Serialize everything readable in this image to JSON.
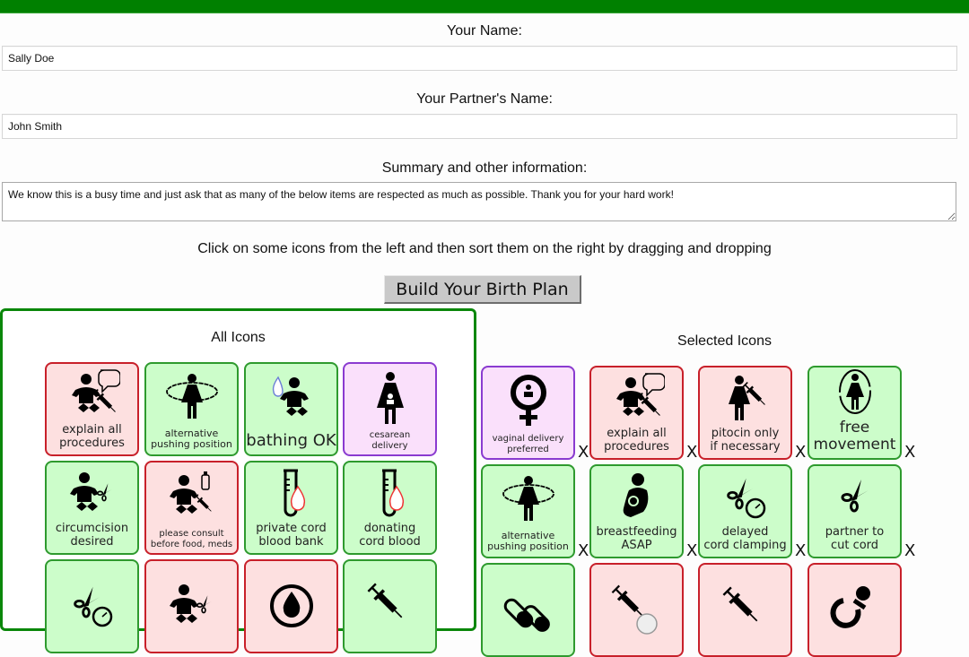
{
  "form": {
    "your_name_label": "Your Name:",
    "your_name_value": "Sally Doe",
    "partner_name_label": "Your Partner's Name:",
    "partner_name_value": "John Smith",
    "summary_label": "Summary and other information:",
    "summary_value": "We know this is a busy time and just ask that as many of the below items are respected as much as possible. Thank you for your hard work!",
    "instructions": "Click on some icons from the left and then sort them on the right by dragging and dropping",
    "build_button_label": "Build Your Birth Plan"
  },
  "colors": {
    "header_bar": "#008000",
    "green_tile_bg": "#ccfdca",
    "green_tile_border": "#2e9a2e",
    "red_tile_bg": "#fde0e0",
    "red_tile_border": "#c8202a",
    "purple_tile_bg": "#fae0fb",
    "purple_tile_border": "#8a3bd0",
    "panel_border": "#0a870a"
  },
  "all_icons": {
    "title": "All Icons",
    "items": [
      {
        "label": "explain all\nprocedures",
        "color": "red",
        "icon": "baby-speech-syringe-icon"
      },
      {
        "label": "alternative\npushing position",
        "color": "green",
        "icon": "woman-orbit-icon"
      },
      {
        "label": "bathing OK",
        "color": "green",
        "icon": "baby-water-drop-icon"
      },
      {
        "label": "cesarean\ndelivery",
        "color": "purple",
        "icon": "woman-with-baby-icon"
      },
      {
        "label": "circumcision\ndesired",
        "color": "green",
        "icon": "baby-scissors-icon"
      },
      {
        "label": "please consult\nbefore food, meds",
        "color": "red",
        "icon": "baby-bottle-syringe-icon"
      },
      {
        "label": "private cord\nblood bank",
        "color": "green",
        "icon": "test-tube-blood-icon"
      },
      {
        "label": "donating\ncord blood",
        "color": "green",
        "icon": "test-tube-blood-icon"
      },
      {
        "label": "",
        "color": "green",
        "icon": "scissors-clock-icon"
      },
      {
        "label": "",
        "color": "red",
        "icon": "baby-scissors-icon"
      },
      {
        "label": "",
        "color": "red",
        "icon": "blood-drop-circle-icon"
      },
      {
        "label": "",
        "color": "green",
        "icon": "syringe-icon"
      }
    ]
  },
  "selected_icons": {
    "title": "Selected Icons",
    "remove_label": "X",
    "items": [
      {
        "label": "vaginal delivery\npreferred",
        "color": "purple",
        "icon": "female-symbol-baby-icon"
      },
      {
        "label": "explain all\nprocedures",
        "color": "red",
        "icon": "baby-speech-syringe-icon"
      },
      {
        "label": "pitocin only\nif necessary",
        "color": "red",
        "icon": "woman-syringe-icon"
      },
      {
        "label": "free\nmovement",
        "color": "green",
        "icon": "woman-circle-icon"
      },
      {
        "label": "alternative\npushing position",
        "color": "green",
        "icon": "woman-orbit-icon"
      },
      {
        "label": "breastfeeding\nASAP",
        "color": "green",
        "icon": "breastfeeding-icon"
      },
      {
        "label": "delayed\ncord clamping",
        "color": "green",
        "icon": "scissors-clock-icon"
      },
      {
        "label": "partner to\ncut cord",
        "color": "green",
        "icon": "scissors-icon"
      },
      {
        "label": "",
        "color": "green",
        "icon": "pills-icon"
      },
      {
        "label": "",
        "color": "red",
        "icon": "syringe-clock-icon"
      },
      {
        "label": "",
        "color": "red",
        "icon": "syringe-icon"
      },
      {
        "label": "",
        "color": "red",
        "icon": "pacifier-icon"
      }
    ]
  }
}
